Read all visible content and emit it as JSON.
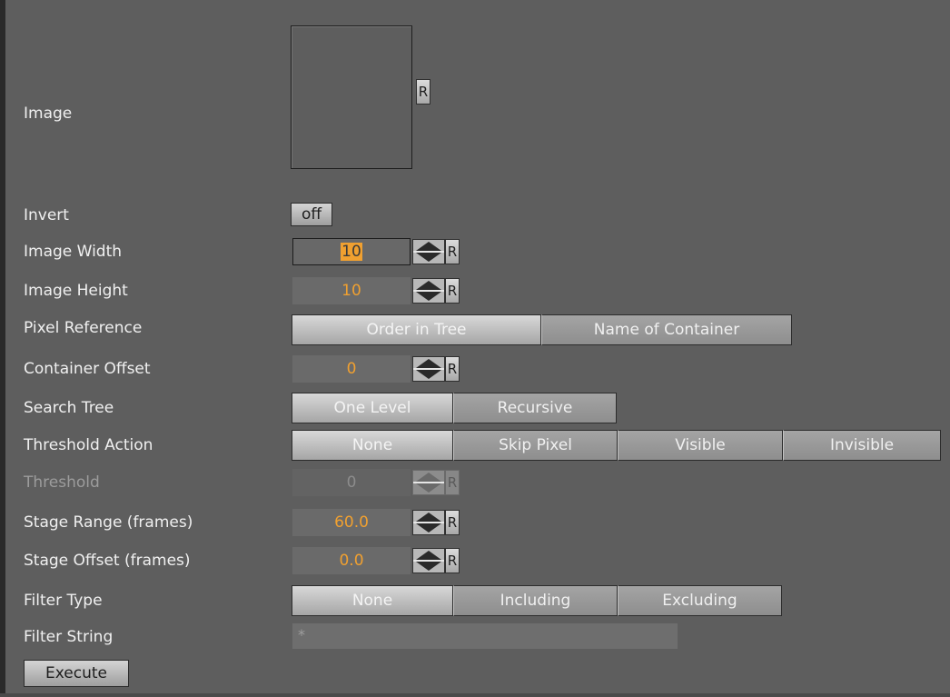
{
  "labels": {
    "image": "Image",
    "invert": "Invert",
    "image_width": "Image Width",
    "image_height": "Image Height",
    "pixel_reference": "Pixel Reference",
    "container_offset": "Container Offset",
    "search_tree": "Search Tree",
    "threshold_action": "Threshold Action",
    "threshold": "Threshold",
    "stage_range": "Stage Range (frames)",
    "stage_offset": "Stage Offset (frames)",
    "filter_type": "Filter Type",
    "filter_string": "Filter String"
  },
  "reset_label": "R",
  "invert_value": "off",
  "values": {
    "image_width": "10",
    "image_height": "10",
    "container_offset": "0",
    "threshold": "0",
    "stage_range": "60.0",
    "stage_offset": "0.0"
  },
  "pixel_reference": {
    "options": [
      "Order in Tree",
      "Name of Container"
    ],
    "selected": "Order in Tree"
  },
  "search_tree": {
    "options": [
      "One Level",
      "Recursive"
    ],
    "selected": "One Level"
  },
  "threshold_action": {
    "options": [
      "None",
      "Skip Pixel",
      "Visible",
      "Invisible"
    ],
    "selected": "None"
  },
  "filter_type": {
    "options": [
      "None",
      "Including",
      "Excluding"
    ],
    "selected": "None"
  },
  "filter_string": "*",
  "execute_label": "Execute",
  "colors": {
    "background": "#5e5e5e",
    "value_accent": "#f0a030",
    "frame": "#2a2a2a"
  }
}
